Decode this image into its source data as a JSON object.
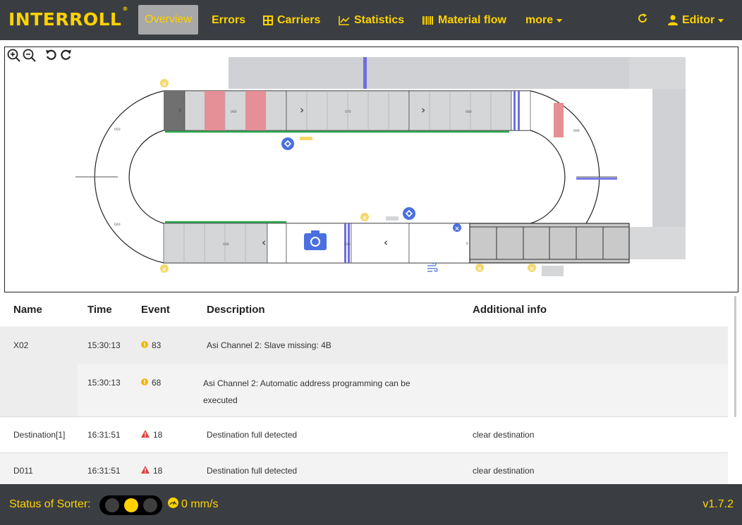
{
  "brand": {
    "logo_text": "INTERROLL",
    "logo_mark": "®"
  },
  "nav": {
    "overview": "Overview",
    "errors": "Errors",
    "carriers": "Carriers",
    "statistics": "Statistics",
    "material_flow": "Material flow",
    "more": "more",
    "editor": "Editor"
  },
  "map": {
    "segment_labels": {
      "s050": "050",
      "s060": "060",
      "s070": "070",
      "s080": "080",
      "s090": "090",
      "s040": "040",
      "s030": "030",
      "s020": "020",
      "s010": "0"
    }
  },
  "table": {
    "headers": {
      "name": "Name",
      "time": "Time",
      "event": "Event",
      "description": "Description",
      "info": "Additional info"
    },
    "rows": [
      {
        "name": "X02",
        "time": "15:30:13",
        "event": "83",
        "severity": "warning",
        "description": "Asi Channel 2: Slave missing: 4B",
        "info": ""
      },
      {
        "name": "",
        "time": "15:30:13",
        "event": "68",
        "severity": "warning",
        "description": "Asi Channel 2: Automatic address programming can be executed",
        "info": ""
      },
      {
        "name": "Destination[1]",
        "time": "16:31:51",
        "event": "18",
        "severity": "error",
        "description": "Destination full detected",
        "info": "clear destination"
      },
      {
        "name": "D011",
        "time": "16:31:51",
        "event": "18",
        "severity": "error",
        "description": "Destination full detected",
        "info": "clear destination"
      }
    ]
  },
  "footer": {
    "status_label": "Status of Sorter:",
    "traffic_light": [
      "off",
      "yellow",
      "off"
    ],
    "speed": "0 mm/s",
    "version": "v1.7.2"
  },
  "colors": {
    "accent": "#ffd200",
    "nav_bg": "#3a3e42",
    "warning": "#f2b705",
    "error": "#e04040"
  }
}
